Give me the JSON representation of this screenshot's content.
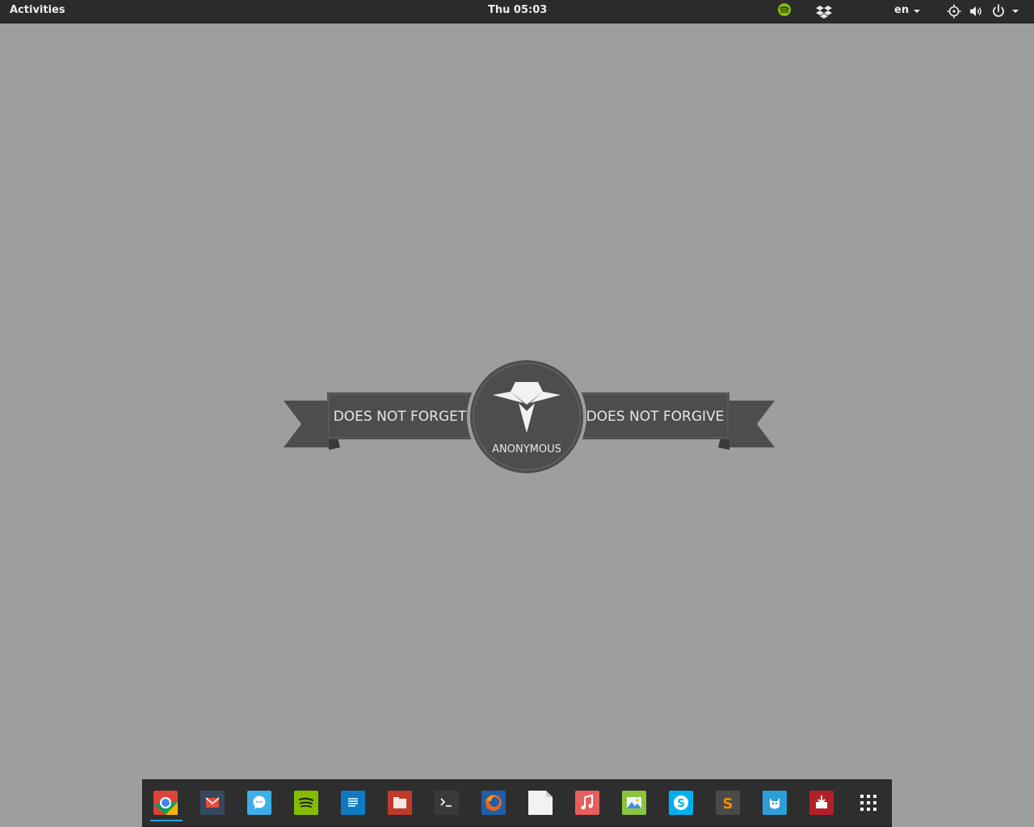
{
  "topbar": {
    "activities_label": "Activities",
    "clock": "Thu 05:03",
    "language": "en",
    "tray_icons": [
      "spotify-icon",
      "dropbox-icon",
      "crosshair-icon",
      "volume-icon",
      "power-icon"
    ]
  },
  "wallpaper": {
    "left_banner_text": "DOES NOT FORGET",
    "right_banner_text": "DOES NOT FORGIVE",
    "circle_text": "ANONYMOUS",
    "background_color": "#9e9e9e",
    "emblem_color": "#4d4d4d"
  },
  "dock": {
    "apps": [
      {
        "name": "chrome-icon",
        "active": true
      },
      {
        "name": "mail-icon"
      },
      {
        "name": "chat-icon"
      },
      {
        "name": "spotify-icon"
      },
      {
        "name": "document-icon"
      },
      {
        "name": "files-icon"
      },
      {
        "name": "terminal-icon"
      },
      {
        "name": "firefox-icon"
      },
      {
        "name": "text-file-icon"
      },
      {
        "name": "music-icon"
      },
      {
        "name": "image-viewer-icon"
      },
      {
        "name": "skype-icon"
      },
      {
        "name": "sublime-text-icon"
      },
      {
        "name": "cat-app-icon"
      },
      {
        "name": "package-installer-icon"
      },
      {
        "name": "app-grid-icon"
      }
    ],
    "accent_color": "#2d9fd8"
  }
}
